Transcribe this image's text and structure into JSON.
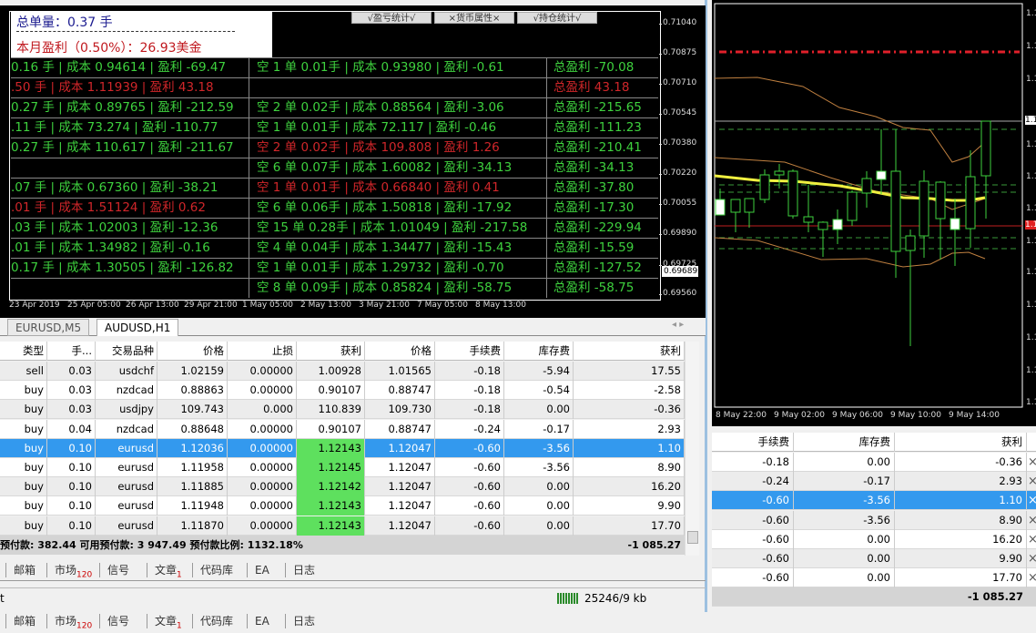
{
  "overlay": {
    "total_lots": "总单量：0.37 手",
    "month_profit": "本月盈利（0.50%）：26.93美金",
    "buttons": [
      "√盈亏统计√",
      "×货币属性×",
      "√持仓统计√"
    ],
    "rows": [
      {
        "c1": "0.16 手 | 成本 0.94614 | 盈利 -69.47",
        "c1red": false,
        "c2": "空 1 单 0.01手 | 成本 0.93980 | 盈利 -0.61",
        "c2red": false,
        "c3": "总盈利 -70.08",
        "c3red": false
      },
      {
        "c1": ".50 手 | 成本 1.11939 | 盈利 43.18",
        "c1red": true,
        "c2": "",
        "c2red": false,
        "c3": "总盈利 43.18",
        "c3red": true
      },
      {
        "c1": "0.27 手 | 成本 0.89765 | 盈利 -212.59",
        "c1red": false,
        "c2": "空 2 单 0.02手 | 成本 0.88564 | 盈利 -3.06",
        "c2red": false,
        "c3": "总盈利 -215.65",
        "c3red": false
      },
      {
        "c1": ".11 手 | 成本 73.274 | 盈利 -110.77",
        "c1red": false,
        "c2": "空 1 单 0.01手 | 成本 72.117 | 盈利 -0.46",
        "c2red": false,
        "c3": "总盈利 -111.23",
        "c3red": false
      },
      {
        "c1": "0.27 手 | 成本 110.617 | 盈利 -211.67",
        "c1red": false,
        "c2": "空 2 单 0.02手 | 成本 109.808 | 盈利 1.26",
        "c2red": true,
        "c3": "总盈利 -210.41",
        "c3red": false
      },
      {
        "c1": "",
        "c1red": false,
        "c2": "空 6 单 0.07手 | 成本 1.60082 | 盈利 -34.13",
        "c2red": false,
        "c3": "总盈利 -34.13",
        "c3red": false
      },
      {
        "c1": ".07 手 | 成本 0.67360 | 盈利 -38.21",
        "c1red": false,
        "c2": "空 1 单 0.01手 | 成本 0.66840 | 盈利 0.41",
        "c2red": true,
        "c3": "总盈利 -37.80",
        "c3red": false
      },
      {
        "c1": ".01 手 | 成本 1.51124 | 盈利 0.62",
        "c1red": true,
        "c2": "空 6 单 0.06手 | 成本 1.50818 | 盈利 -17.92",
        "c2red": false,
        "c3": "总盈利 -17.30",
        "c3red": false
      },
      {
        "c1": ".03 手 | 成本 1.02003 | 盈利 -12.36",
        "c1red": false,
        "c2": "空 15 单 0.28手 | 成本 1.01049 | 盈利 -217.58",
        "c2red": false,
        "c3": "总盈利 -229.94",
        "c3red": false
      },
      {
        "c1": ".01 手 | 成本 1.34982 | 盈利 -0.16",
        "c1red": false,
        "c2": "空 4 单 0.04手 | 成本 1.34477 | 盈利 -15.43",
        "c2red": false,
        "c3": "总盈利 -15.59",
        "c3red": false
      },
      {
        "c1": "0.17 手 | 成本 1.30505 | 盈利 -126.82",
        "c1red": false,
        "c2": "空 1 单 0.01手 | 成本 1.29732 | 盈利 -0.70",
        "c2red": false,
        "c3": "总盈利 -127.52",
        "c3red": false
      },
      {
        "c1": "",
        "c1red": false,
        "c2": "空 8 单 0.09手 | 成本 0.85824 | 盈利 -58.75",
        "c2red": false,
        "c3": "总盈利 -58.75",
        "c3red": false
      }
    ]
  },
  "left_chart": {
    "price_axis": [
      "0.71040",
      "0.70875",
      "0.70710",
      "0.70545",
      "0.70380",
      "0.70220",
      "0.70055",
      "0.69890",
      "0.69725",
      "0.69560"
    ],
    "current_price": "0.69689",
    "time_axis": [
      "23 Apr 2019",
      "25 Apr 05:00",
      "26 Apr 13:00",
      "29 Apr 21:00",
      "1 May 05:00",
      "2 May 13:00",
      "3 May 21:00",
      "7 May 05:00",
      "8 May 13:00"
    ]
  },
  "chart_tabs": [
    "EURUSD,M5",
    "AUDUSD,H1"
  ],
  "trade_table": {
    "headers": [
      "类型",
      "手...",
      "交易品种",
      "价格",
      "止损",
      "获利",
      "价格",
      "手续费",
      "库存费",
      "获利"
    ],
    "rows": [
      [
        "sell",
        "0.03",
        "usdchf",
        "1.02159",
        "0.00000",
        "1.00928",
        "1.01565",
        "-0.18",
        "-5.94",
        "17.55"
      ],
      [
        "buy",
        "0.03",
        "nzdcad",
        "0.88863",
        "0.00000",
        "0.90107",
        "0.88747",
        "-0.18",
        "-0.54",
        "-2.58"
      ],
      [
        "buy",
        "0.03",
        "usdjpy",
        "109.743",
        "0.000",
        "110.839",
        "109.730",
        "-0.18",
        "0.00",
        "-0.36"
      ],
      [
        "buy",
        "0.04",
        "nzdcad",
        "0.88648",
        "0.00000",
        "0.90107",
        "0.88747",
        "-0.24",
        "-0.17",
        "2.93"
      ],
      [
        "buy",
        "0.10",
        "eurusd",
        "1.12036",
        "0.00000",
        "1.12143",
        "1.12047",
        "-0.60",
        "-3.56",
        "1.10"
      ],
      [
        "buy",
        "0.10",
        "eurusd",
        "1.11958",
        "0.00000",
        "1.12145",
        "1.12047",
        "-0.60",
        "-3.56",
        "8.90"
      ],
      [
        "buy",
        "0.10",
        "eurusd",
        "1.11885",
        "0.00000",
        "1.12142",
        "1.12047",
        "-0.60",
        "0.00",
        "16.20"
      ],
      [
        "buy",
        "0.10",
        "eurusd",
        "1.11948",
        "0.00000",
        "1.12143",
        "1.12047",
        "-0.60",
        "0.00",
        "9.90"
      ],
      [
        "buy",
        "0.10",
        "eurusd",
        "1.11870",
        "0.00000",
        "1.12143",
        "1.12047",
        "-0.60",
        "0.00",
        "17.70"
      ]
    ],
    "selected_row": 4,
    "summary": "预付款: 382.44   可用预付款: 3 947.49   预付款比例: 1132.18%",
    "total": "-1 085.27"
  },
  "bottom_tabs": [
    {
      "label": "邮箱",
      "badge": ""
    },
    {
      "label": "市场",
      "badge": "120"
    },
    {
      "label": "信号",
      "badge": ""
    },
    {
      "label": "文章",
      "badge": "1"
    },
    {
      "label": "代码库",
      "badge": ""
    },
    {
      "label": "EA",
      "badge": ""
    },
    {
      "label": "日志",
      "badge": ""
    }
  ],
  "status": {
    "left": "t",
    "traffic": "25246/9 kb"
  },
  "right_chart": {
    "price_label": "1.1",
    "time_axis": [
      "8 May 22:00",
      "9 May 02:00",
      "9 May 06:00",
      "9 May 10:00",
      "9 May 14:00"
    ]
  },
  "right_table": {
    "headers": [
      "手续费",
      "库存费",
      "获利"
    ],
    "rows": [
      [
        "-0.18",
        "0.00",
        "-0.36"
      ],
      [
        "-0.24",
        "-0.17",
        "2.93"
      ],
      [
        "-0.60",
        "-3.56",
        "1.10"
      ],
      [
        "-0.60",
        "-3.56",
        "8.90"
      ],
      [
        "-0.60",
        "0.00",
        "16.20"
      ],
      [
        "-0.60",
        "0.00",
        "9.90"
      ],
      [
        "-0.60",
        "0.00",
        "17.70"
      ]
    ],
    "selected_row": 2,
    "total": "-1 085.27",
    "close_icon": "×"
  }
}
